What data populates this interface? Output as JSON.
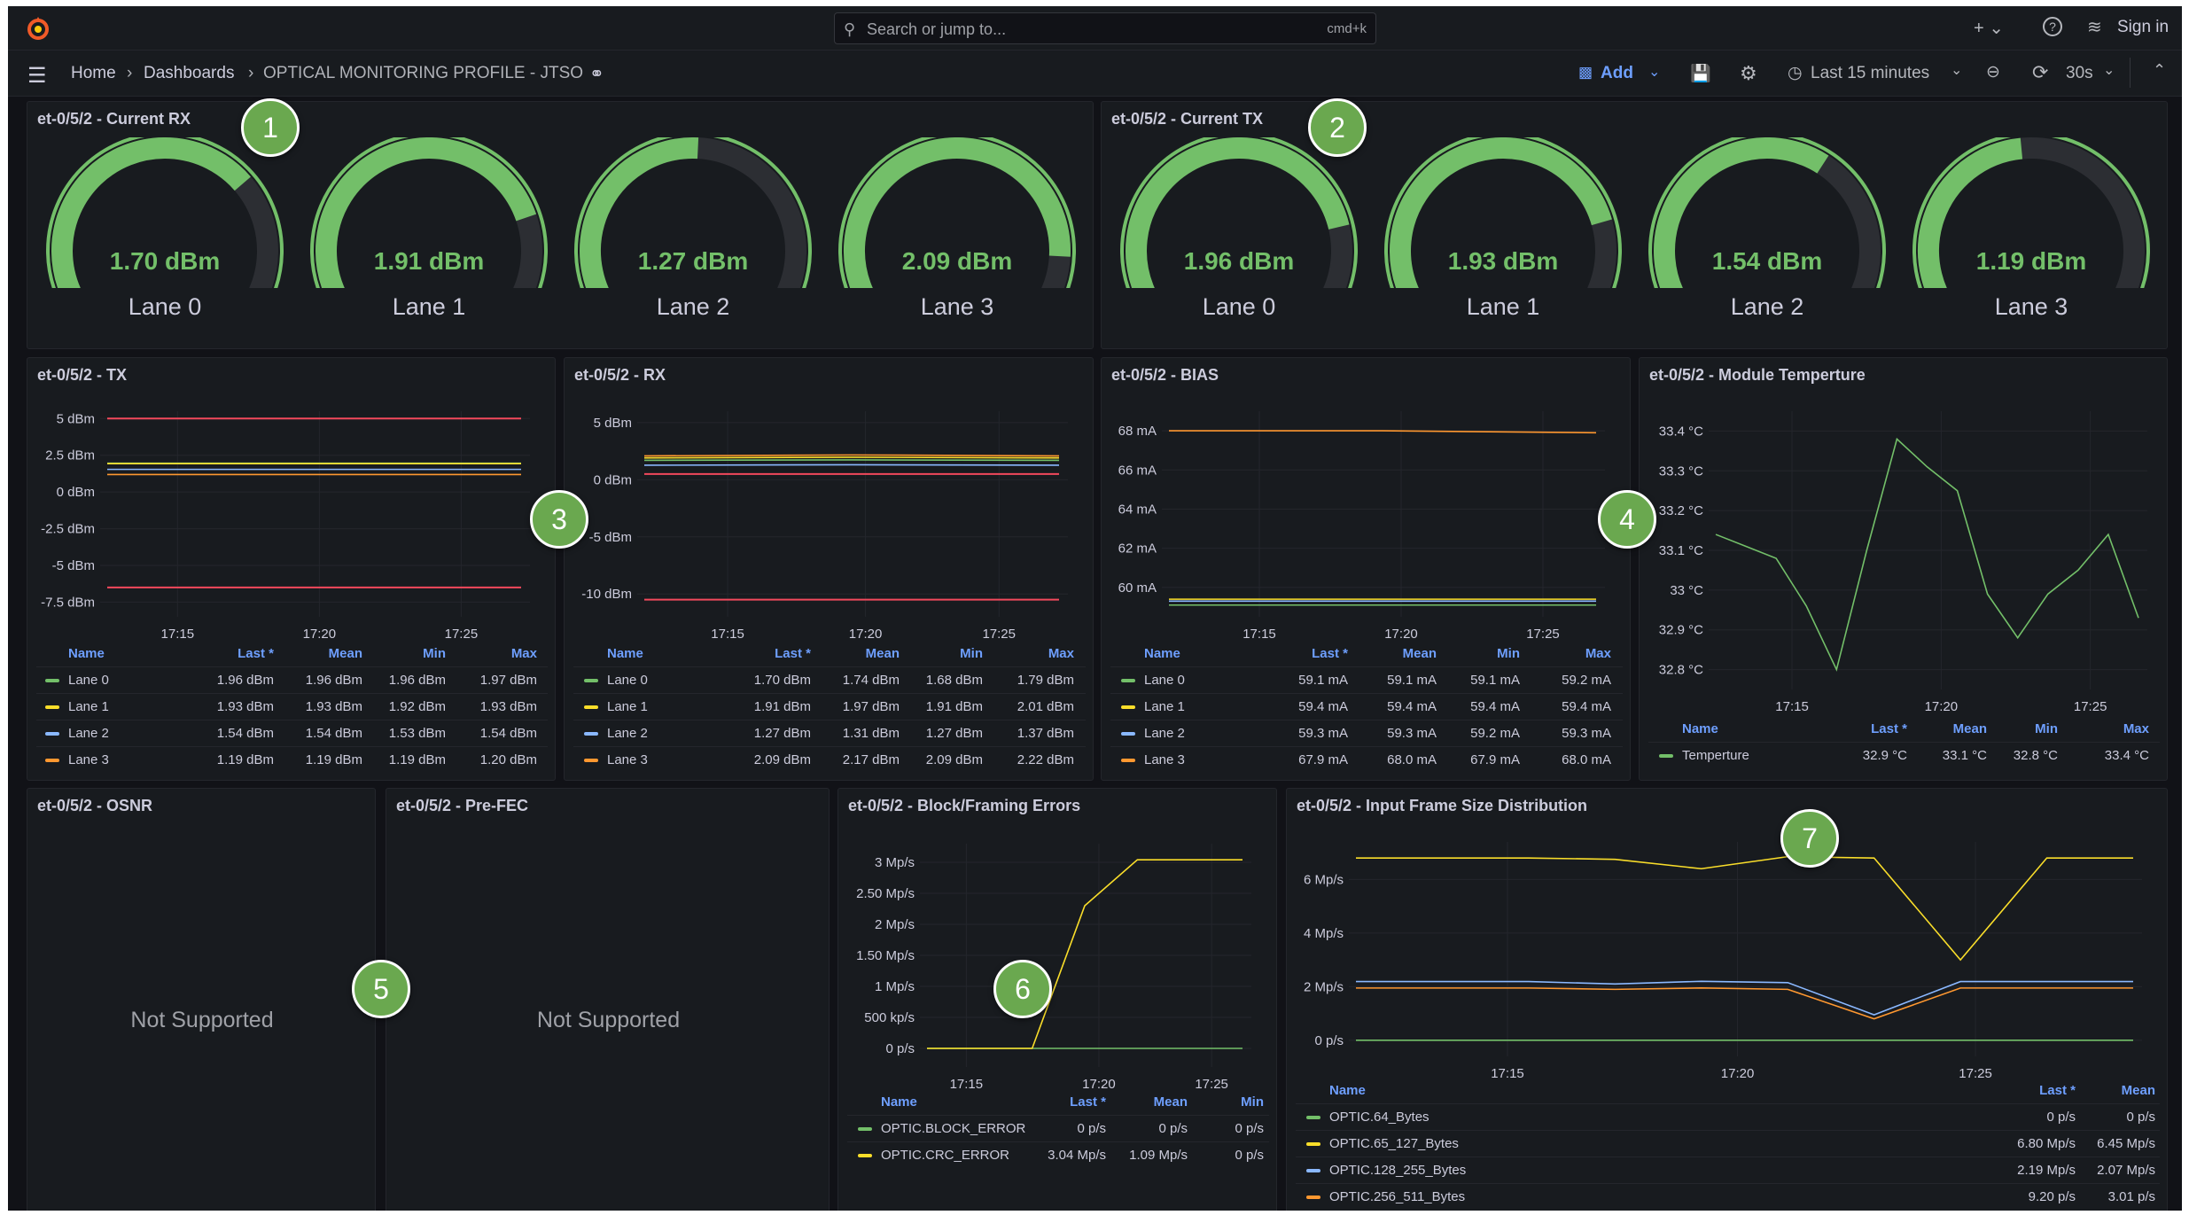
{
  "topbar": {
    "search_placeholder": "Search or jump to...",
    "search_shortcut": "cmd+k",
    "add_icon": "plus-icon",
    "help_icon": "help-icon",
    "rss_icon": "rss-icon",
    "sign_in": "Sign in"
  },
  "navbar": {
    "breadcrumbs": [
      "Home",
      "Dashboards",
      "OPTICAL MONITORING PROFILE - JTSO"
    ],
    "add_label": "Add",
    "time_range": "Last 15 minutes",
    "refresh_interval": "30s"
  },
  "colors": {
    "green": "#73bf69",
    "yellow": "#fade2a",
    "blue": "#8ab8ff",
    "orange": "#ff9830",
    "red": "#f2495c",
    "accent": "#6e9fff",
    "badge": "#6aa84f"
  },
  "annotations": [
    "1",
    "2",
    "3",
    "4",
    "5",
    "6",
    "7"
  ],
  "gauge_panels": [
    {
      "title": "et-0/5/2 - Current RX",
      "gauges": [
        {
          "value": "1.70 dBm",
          "fraction": 0.68,
          "label": "Lane 0"
        },
        {
          "value": "1.91 dBm",
          "fraction": 0.76,
          "label": "Lane 1"
        },
        {
          "value": "1.27 dBm",
          "fraction": 0.51,
          "label": "Lane 2"
        },
        {
          "value": "2.09 dBm",
          "fraction": 0.84,
          "label": "Lane 3"
        }
      ]
    },
    {
      "title": "et-0/5/2 - Current TX",
      "gauges": [
        {
          "value": "1.96 dBm",
          "fraction": 0.78,
          "label": "Lane 0"
        },
        {
          "value": "1.93 dBm",
          "fraction": 0.77,
          "label": "Lane 1"
        },
        {
          "value": "1.54 dBm",
          "fraction": 0.62,
          "label": "Lane 2"
        },
        {
          "value": "1.19 dBm",
          "fraction": 0.48,
          "label": "Lane 3"
        }
      ]
    }
  ],
  "panels": {
    "osnr": {
      "title": "et-0/5/2 - OSNR",
      "message": "Not Supported"
    },
    "prefec": {
      "title": "et-0/5/2 - Pre-FEC",
      "message": "Not Supported"
    }
  },
  "chart_data": [
    {
      "id": "tx",
      "title": "et-0/5/2 - TX",
      "type": "line",
      "ylim": [
        -8.5,
        5.5
      ],
      "yticks": [
        5,
        2.5,
        0,
        -2.5,
        -5,
        -7.5
      ],
      "ytick_labels": [
        "5 dBm",
        "2.5 dBm",
        "0 dBm",
        "-2.5 dBm",
        "-5 dBm",
        "-7.5 dBm"
      ],
      "x": [
        "17:11",
        "17:26"
      ],
      "xticks": [
        "17:15",
        "17:20",
        "17:25"
      ],
      "legend_columns": [
        "Name",
        "Last *",
        "Mean",
        "Min",
        "Max"
      ],
      "series": [
        {
          "name": "Lane 0",
          "color": "green",
          "values": [
            1.96,
            1.96
          ],
          "stats": [
            "1.96 dBm",
            "1.96 dBm",
            "1.96 dBm",
            "1.97 dBm"
          ]
        },
        {
          "name": "Lane 1",
          "color": "yellow",
          "values": [
            1.93,
            1.93
          ],
          "stats": [
            "1.93 dBm",
            "1.93 dBm",
            "1.92 dBm",
            "1.93 dBm"
          ]
        },
        {
          "name": "Lane 2",
          "color": "blue",
          "values": [
            1.54,
            1.54
          ],
          "stats": [
            "1.54 dBm",
            "1.54 dBm",
            "1.53 dBm",
            "1.54 dBm"
          ]
        },
        {
          "name": "Lane 3",
          "color": "orange",
          "values": [
            1.19,
            1.19
          ],
          "stats": [
            "1.19 dBm",
            "1.19 dBm",
            "1.19 dBm",
            "1.20 dBm"
          ]
        }
      ],
      "thresholds": [
        {
          "color": "red",
          "value": 5.0
        },
        {
          "color": "red",
          "value": -6.5
        }
      ]
    },
    {
      "id": "rx",
      "title": "et-0/5/2 - RX",
      "type": "line",
      "ylim": [
        -12,
        6
      ],
      "yticks": [
        5,
        0,
        -5,
        -10
      ],
      "ytick_labels": [
        "5 dBm",
        "0 dBm",
        "-5 dBm",
        "-10 dBm"
      ],
      "x": [
        "17:11",
        "17:26"
      ],
      "xticks": [
        "17:15",
        "17:20",
        "17:25"
      ],
      "legend_columns": [
        "Name",
        "Last *",
        "Mean",
        "Min",
        "Max"
      ],
      "series": [
        {
          "name": "Lane 0",
          "color": "green",
          "values": [
            1.7,
            1.74,
            1.7
          ],
          "stats": [
            "1.70 dBm",
            "1.74 dBm",
            "1.68 dBm",
            "1.79 dBm"
          ]
        },
        {
          "name": "Lane 1",
          "color": "yellow",
          "values": [
            1.91,
            1.97,
            1.91
          ],
          "stats": [
            "1.91 dBm",
            "1.97 dBm",
            "1.91 dBm",
            "2.01 dBm"
          ]
        },
        {
          "name": "Lane 2",
          "color": "blue",
          "values": [
            1.27,
            1.31,
            1.27
          ],
          "stats": [
            "1.27 dBm",
            "1.31 dBm",
            "1.27 dBm",
            "1.37 dBm"
          ]
        },
        {
          "name": "Lane 3",
          "color": "orange",
          "values": [
            2.09,
            2.17,
            2.09
          ],
          "stats": [
            "2.09 dBm",
            "2.17 dBm",
            "2.09 dBm",
            "2.22 dBm"
          ]
        }
      ],
      "thresholds": [
        {
          "color": "red",
          "value": 0.5
        },
        {
          "color": "red",
          "value": -10.5
        }
      ]
    },
    {
      "id": "bias",
      "title": "et-0/5/2 - BIAS",
      "type": "line",
      "ylim": [
        58.5,
        69
      ],
      "yticks": [
        68,
        66,
        64,
        62,
        60
      ],
      "ytick_labels": [
        "68 mA",
        "66 mA",
        "64 mA",
        "62 mA",
        "60 mA"
      ],
      "x": [
        "17:11",
        "17:26"
      ],
      "xticks": [
        "17:15",
        "17:20",
        "17:25"
      ],
      "legend_columns": [
        "Name",
        "Last *",
        "Mean",
        "Min",
        "Max"
      ],
      "series": [
        {
          "name": "Lane 0",
          "color": "green",
          "values": [
            59.1,
            59.1,
            59.1
          ],
          "stats": [
            "59.1 mA",
            "59.1 mA",
            "59.1 mA",
            "59.2 mA"
          ]
        },
        {
          "name": "Lane 1",
          "color": "yellow",
          "values": [
            59.4,
            59.4,
            59.4
          ],
          "stats": [
            "59.4 mA",
            "59.4 mA",
            "59.4 mA",
            "59.4 mA"
          ]
        },
        {
          "name": "Lane 2",
          "color": "blue",
          "values": [
            59.3,
            59.3,
            59.3
          ],
          "stats": [
            "59.3 mA",
            "59.3 mA",
            "59.2 mA",
            "59.3 mA"
          ]
        },
        {
          "name": "Lane 3",
          "color": "orange",
          "values": [
            68.0,
            68.0,
            67.9
          ],
          "stats": [
            "67.9 mA",
            "68.0 mA",
            "67.9 mA",
            "68.0 mA"
          ]
        }
      ],
      "thresholds": []
    },
    {
      "id": "temp",
      "title": "et-0/5/2 - Module Temperture",
      "type": "line",
      "ylim": [
        32.75,
        33.45
      ],
      "yticks": [
        33.4,
        33.3,
        33.2,
        33.1,
        33.0,
        32.9,
        32.8
      ],
      "ytick_labels": [
        "33.4 °C",
        "33.3 °C",
        "33.2 °C",
        "33.1 °C",
        "33 °C",
        "32.9 °C",
        "32.8 °C"
      ],
      "x": [
        "17:11",
        "17:26"
      ],
      "xticks": [
        "17:15",
        "17:20",
        "17:25"
      ],
      "legend_columns": [
        "Name",
        "Last *",
        "Mean",
        "Min",
        "Max"
      ],
      "series": [
        {
          "name": "Temperture",
          "color": "green",
          "values": [
            33.14,
            33.11,
            33.08,
            32.96,
            32.8,
            33.1,
            33.38,
            33.31,
            33.25,
            32.99,
            32.88,
            32.99,
            33.05,
            33.14,
            32.93
          ],
          "stats": [
            "32.9 °C",
            "33.1 °C",
            "32.8 °C",
            "33.4 °C"
          ]
        }
      ],
      "thresholds": []
    },
    {
      "id": "errors",
      "title": "et-0/5/2 - Block/Framing Errors",
      "type": "line",
      "ylim": [
        -0.3,
        3.3
      ],
      "yticks": [
        3,
        2.5,
        2,
        1.5,
        1,
        0.5,
        0
      ],
      "ytick_labels": [
        "3 Mp/s",
        "2.50 Mp/s",
        "2 Mp/s",
        "1.50 Mp/s",
        "1 Mp/s",
        "500 kp/s",
        "0 p/s"
      ],
      "x": [
        "17:11",
        "17:26"
      ],
      "xticks": [
        "17:15",
        "17:20",
        "17:25"
      ],
      "legend_columns": [
        "Name",
        "Last *",
        "Mean",
        "Min"
      ],
      "series": [
        {
          "name": "OPTIC.BLOCK_ERROR",
          "color": "green",
          "values": [
            0,
            0,
            0,
            0
          ],
          "stats": [
            "0 p/s",
            "0 p/s",
            "0 p/s"
          ]
        },
        {
          "name": "OPTIC.CRC_ERROR",
          "color": "yellow",
          "values": [
            0,
            0,
            0,
            2.3,
            3.04,
            3.04,
            3.04
          ],
          "stats": [
            "3.04 Mp/s",
            "1.09 Mp/s",
            "0 p/s"
          ]
        }
      ],
      "thresholds": []
    },
    {
      "id": "framesize",
      "title": "et-0/5/2 - Input Frame Size Distribution",
      "type": "line",
      "ylim": [
        -0.6,
        7.4
      ],
      "yticks": [
        6,
        4,
        2,
        0
      ],
      "ytick_labels": [
        "6 Mp/s",
        "4 Mp/s",
        "2 Mp/s",
        "0 p/s"
      ],
      "x": [
        "17:11",
        "17:26"
      ],
      "xticks": [
        "17:15",
        "17:20",
        "17:25"
      ],
      "legend_columns": [
        "Name",
        "Last *",
        "Mean"
      ],
      "series": [
        {
          "name": "OPTIC.64_Bytes",
          "color": "green",
          "values": [
            0,
            0,
            0,
            0,
            0,
            0,
            0,
            0,
            0,
            0
          ],
          "stats": [
            "0 p/s",
            "0 p/s"
          ]
        },
        {
          "name": "OPTIC.65_127_Bytes",
          "color": "yellow",
          "values": [
            6.8,
            6.8,
            6.8,
            6.75,
            6.4,
            6.85,
            6.8,
            3.0,
            6.8,
            6.8
          ],
          "stats": [
            "6.80 Mp/s",
            "6.45 Mp/s"
          ]
        },
        {
          "name": "OPTIC.128_255_Bytes",
          "color": "blue",
          "values": [
            2.19,
            2.19,
            2.19,
            2.1,
            2.2,
            2.15,
            0.95,
            2.19,
            2.19,
            2.19
          ],
          "stats": [
            "2.19 Mp/s",
            "2.07 Mp/s"
          ]
        },
        {
          "name": "OPTIC.256_511_Bytes",
          "color": "orange",
          "values": [
            1.95,
            1.95,
            1.95,
            1.9,
            1.95,
            1.9,
            0.8,
            1.95,
            1.95,
            1.95
          ],
          "stats": [
            "9.20 p/s",
            "3.01 p/s"
          ]
        }
      ],
      "thresholds": []
    }
  ]
}
